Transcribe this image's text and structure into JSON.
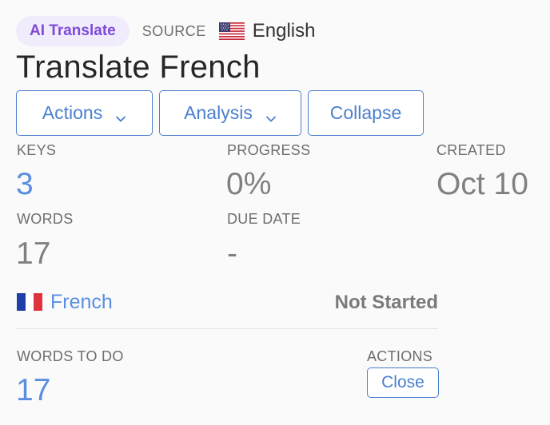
{
  "header": {
    "badge": "AI Translate",
    "source_label": "SOURCE",
    "source_language": "English",
    "source_flag_icon": "us-flag-icon"
  },
  "title": "Translate French",
  "buttons": {
    "actions": "Actions",
    "analysis": "Analysis",
    "collapse": "Collapse"
  },
  "stats": {
    "keys_label": "KEYS",
    "keys_value": "3",
    "progress_label": "PROGRESS",
    "progress_value": "0%",
    "created_label": "CREATED",
    "created_value": "Oct 10",
    "words_label": "WORDS",
    "words_value": "17",
    "due_label": "DUE DATE",
    "due_value": "-"
  },
  "language": {
    "flag_icon": "fr-flag-icon",
    "name": "French",
    "status": "Not Started"
  },
  "todo": {
    "words_label": "WORDS TO DO",
    "words_value": "17",
    "actions_label": "ACTIONS",
    "close_label": "Close"
  },
  "colors": {
    "accent": "#4a7fcf",
    "link_blue": "#5a8fe0",
    "badge_bg": "#f1ecfb",
    "badge_text": "#7f4ad9"
  }
}
